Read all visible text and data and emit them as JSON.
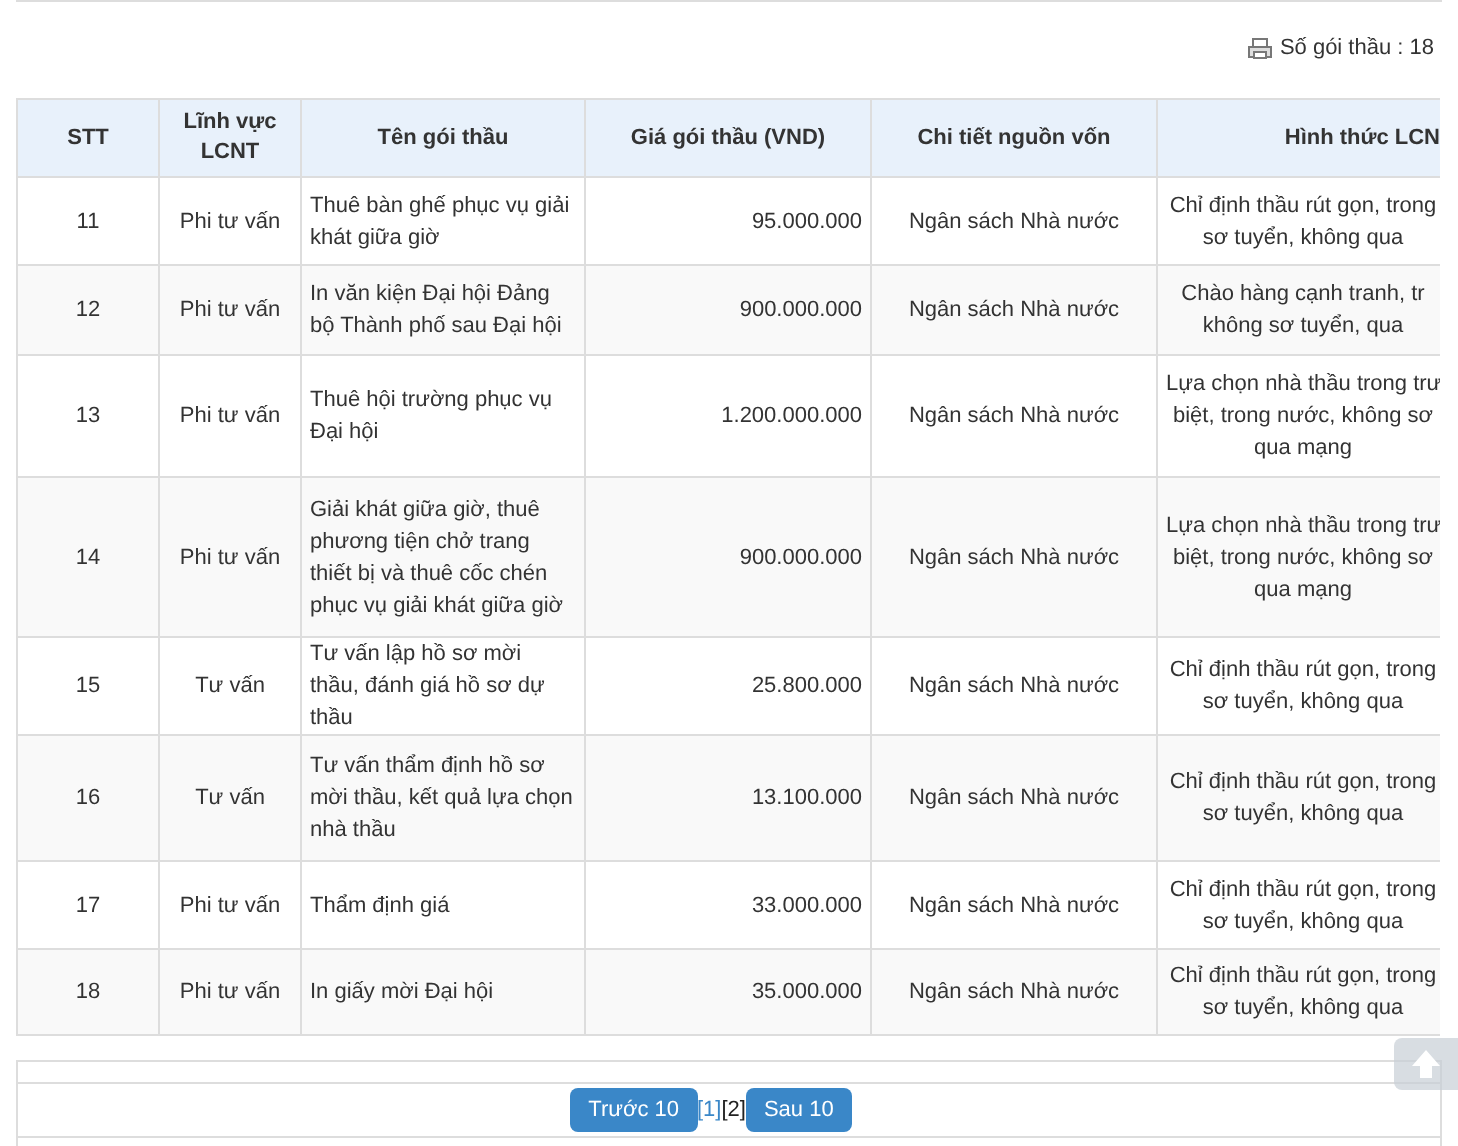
{
  "package_count": {
    "label": "Số gói thầu : 18"
  },
  "table": {
    "columns": [
      "STT",
      "Lĩnh vực LCNT",
      "Tên gói thầu",
      "Giá gói thầu (VND)",
      "Chi tiết nguồn vốn",
      "Hình thức LCN"
    ],
    "rows": [
      {
        "cells": [
          "11",
          "Phi tư vấn",
          "Thuê bàn ghế phục vụ giải khát giữa giờ",
          "95.000.000",
          "Ngân sách Nhà nước",
          "Chỉ định thầu rút gọn, trong\nsơ tuyển, không qua"
        ]
      },
      {
        "cells": [
          "12",
          "Phi tư vấn",
          "In văn kiện Đại hội Đảng bộ Thành phố sau Đại hội",
          "900.000.000",
          "Ngân sách Nhà nước",
          "Chào hàng cạnh tranh, tr\nkhông sơ tuyển, qua"
        ]
      },
      {
        "cells": [
          "13",
          "Phi tư vấn",
          "Thuê hội trường phục vụ Đại hội",
          "1.200.000.000",
          "Ngân sách Nhà nước",
          "Lựa chọn nhà thầu trong trư\nbiệt, trong nước, không sơ\nqua mạng"
        ]
      },
      {
        "cells": [
          "14",
          "Phi tư vấn",
          "Giải khát giữa giờ, thuê phương tiện chở trang thiết bị và thuê cốc chén phục vụ giải khát giữa giờ",
          "900.000.000",
          "Ngân sách Nhà nước",
          "Lựa chọn nhà thầu trong trư\nbiệt, trong nước, không sơ\nqua mạng"
        ]
      },
      {
        "cells": [
          "15",
          "Tư vấn",
          "Tư vấn lập hồ sơ mời thầu, đánh giá hồ sơ dự thầu",
          "25.800.000",
          "Ngân sách Nhà nước",
          "Chỉ định thầu rút gọn, trong\nsơ tuyển, không qua"
        ]
      },
      {
        "cells": [
          "16",
          "Tư vấn",
          "Tư vấn thẩm định hồ sơ mời thầu, kết quả lựa chọn nhà thầu",
          "13.100.000",
          "Ngân sách Nhà nước",
          "Chỉ định thầu rút gọn, trong\nsơ tuyển, không qua"
        ]
      },
      {
        "cells": [
          "17",
          "Phi tư vấn",
          "Thẩm định giá",
          "33.000.000",
          "Ngân sách Nhà nước",
          "Chỉ định thầu rút gọn, trong\nsơ tuyển, không qua"
        ]
      },
      {
        "cells": [
          "18",
          "Phi tư vấn",
          "In giấy mời Đại hội",
          "35.000.000",
          "Ngân sách Nhà nước",
          "Chỉ định thầu rút gọn, trong\nsơ tuyển, không qua"
        ]
      }
    ]
  },
  "pagination": {
    "previous": "Trước 10",
    "pages": [
      {
        "label": "[1]",
        "selected": false
      },
      {
        "label": "[2]",
        "selected": true
      }
    ],
    "next": "Sau 10"
  }
}
